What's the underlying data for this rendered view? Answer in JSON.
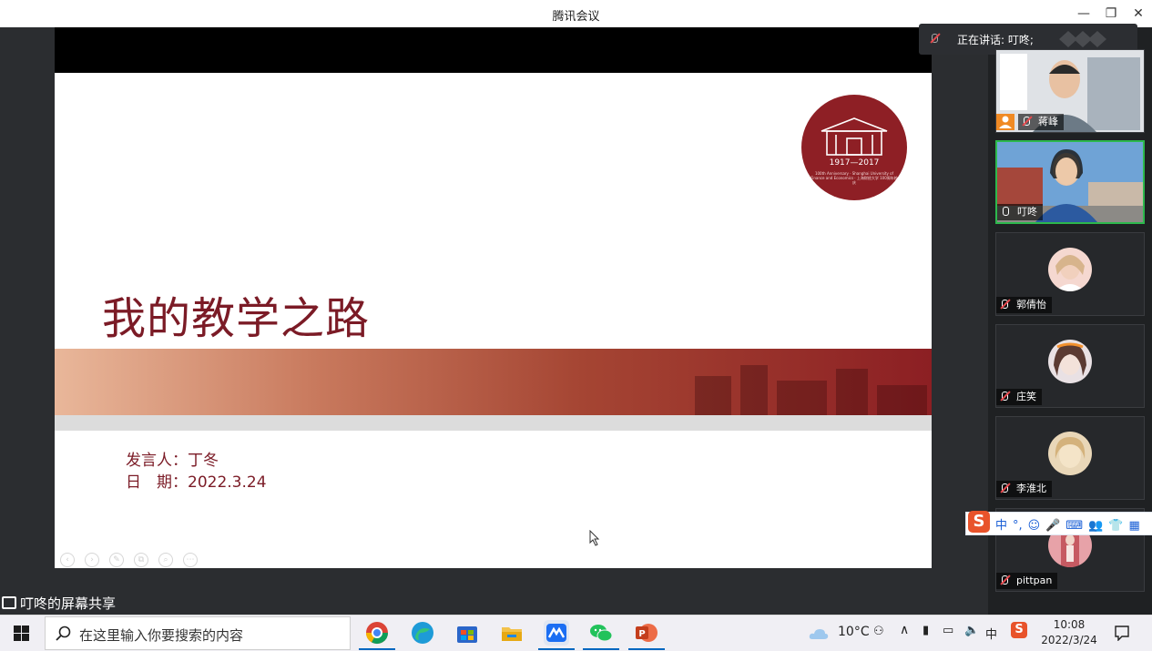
{
  "window": {
    "title": "腾讯会议",
    "minimize": "—",
    "maximize": "❐",
    "close": "✕"
  },
  "speaking": {
    "text": "正在讲话: 叮咚;"
  },
  "slide": {
    "title": "我的教学之路",
    "presenter_line": "发言人：丁冬",
    "date_line": "日　期：2022.3.24",
    "logo_years": "1917—2017",
    "logo_sub": "100th Anniversary · Shanghai University of Finance and Economics · 上海财经大学 100周年校庆"
  },
  "share_label": "叮咚的屏幕共享",
  "participants": [
    {
      "name": "蒋峰",
      "mic": "muted",
      "video": true,
      "host": true
    },
    {
      "name": "叮咚",
      "mic": "on",
      "video": true,
      "active": true
    },
    {
      "name": "郭倩怡",
      "mic": "muted",
      "video": false
    },
    {
      "name": "庄笑",
      "mic": "muted",
      "video": false
    },
    {
      "name": "李淮北",
      "mic": "muted",
      "video": false
    },
    {
      "name": "pittpan",
      "mic": "muted",
      "video": false
    }
  ],
  "ime": {
    "mode": "中",
    "punct": "°,",
    "items": [
      "☺",
      "🎤",
      "⌨",
      "👥",
      "👕",
      "▦"
    ]
  },
  "taskbar": {
    "search_placeholder": "在这里输入你要搜索的内容",
    "weather": "10°C",
    "ime_indicator": "中",
    "time": "10:08",
    "date": "2022/3/24"
  },
  "colors": {
    "slide_accent": "#7b1b26",
    "active_speaker": "#2db84d",
    "taskbar_bg": "#f0eff4"
  }
}
